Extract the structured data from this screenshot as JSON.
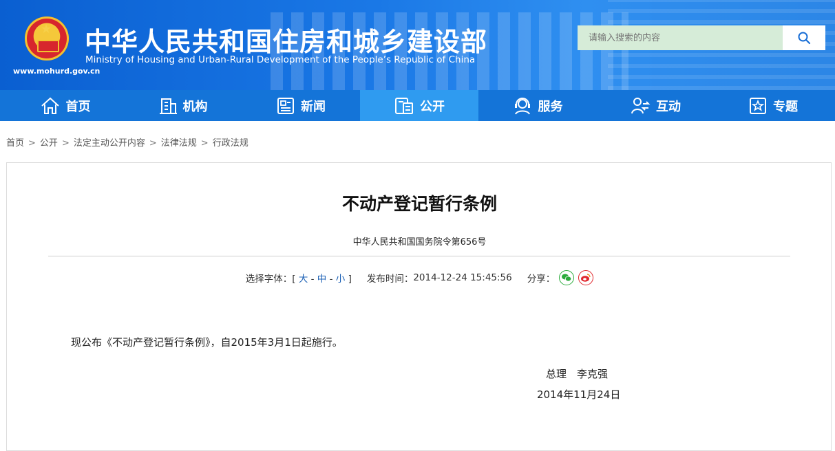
{
  "header": {
    "site_url": "www.mohurd.gov.cn",
    "title": "中华人民共和国住房和城乡建设部",
    "subtitle": "Ministry of Housing and Urban-Rural Development of the People’s Republic of China",
    "search_placeholder": "请输入搜索的内容"
  },
  "nav": {
    "items": [
      {
        "label": "首页",
        "icon": "home-icon"
      },
      {
        "label": "机构",
        "icon": "building-icon"
      },
      {
        "label": "新闻",
        "icon": "news-icon"
      },
      {
        "label": "公开",
        "icon": "disclosure-icon",
        "active": true
      },
      {
        "label": "服务",
        "icon": "service-icon"
      },
      {
        "label": "互动",
        "icon": "interaction-icon"
      },
      {
        "label": "专题",
        "icon": "topic-icon"
      }
    ]
  },
  "breadcrumb": [
    "首页",
    "公开",
    "法定主动公开内容",
    "法律法规",
    "行政法规"
  ],
  "breadcrumb_sep": ">",
  "article": {
    "title": "不动产登记暂行条例",
    "doc_number": "中华人民共和国国务院令第656号",
    "font_label": "选择字体：[",
    "font_large": "大",
    "font_medium": "中",
    "font_small": "小",
    "font_dash": "-",
    "font_close": "]",
    "publish_label": "发布时间：",
    "publish_time": "2014-12-24 15:45:56",
    "share_label": "分享：",
    "body": "现公布《不动产登记暂行条例》，自2015年3月1日起施行。",
    "signature": "总理　李克强",
    "date": "2014年11月24日"
  },
  "colors": {
    "header_blue": "#1a78e6",
    "nav_blue": "#1474d8",
    "nav_active": "#2f9bf0",
    "link_blue": "#1a5fb4"
  }
}
